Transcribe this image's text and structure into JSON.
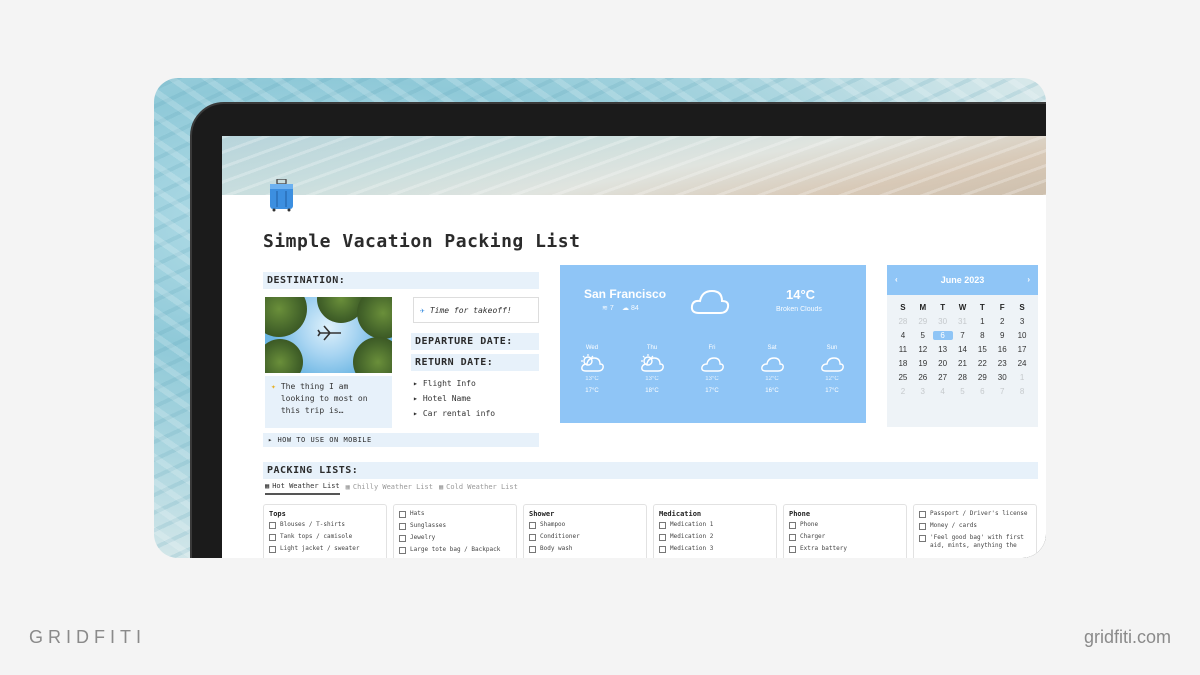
{
  "page": {
    "title": "Simple Vacation Packing List",
    "destination_label": "DESTINATION:",
    "callout": "Time for takeoff!",
    "departure_label": "DEPARTURE DATE:",
    "return_label": "RETURN DATE:",
    "toggles": [
      "Flight Info",
      "Hotel Name",
      "Car rental info"
    ],
    "note": "The thing I am looking to most on this trip is…",
    "mobile_toggle": "HOW TO USE ON MOBILE",
    "packing_label": "PACKING LISTS:"
  },
  "weather": {
    "city": "San Francisco",
    "wind": "7",
    "humidity": "84",
    "temp": "14°C",
    "condition": "Broken Clouds",
    "days": [
      {
        "name": "Wed",
        "low": "13°C",
        "high": "17°C",
        "icon": "sun-cloud-icon"
      },
      {
        "name": "Thu",
        "low": "13°C",
        "high": "18°C",
        "icon": "sun-cloud-icon"
      },
      {
        "name": "Fri",
        "low": "13°C",
        "high": "17°C",
        "icon": "cloud-icon"
      },
      {
        "name": "Sat",
        "low": "12°C",
        "high": "16°C",
        "icon": "cloud-icon"
      },
      {
        "name": "Sun",
        "low": "12°C",
        "high": "17°C",
        "icon": "cloud-icon"
      }
    ]
  },
  "calendar": {
    "month": "June 2023",
    "prev": "‹",
    "next": "›",
    "weekdays": [
      "S",
      "M",
      "T",
      "W",
      "T",
      "F",
      "S"
    ],
    "weeks": [
      [
        "28",
        "29",
        "30",
        "31",
        "1",
        "2",
        "3"
      ],
      [
        "4",
        "5",
        "6",
        "7",
        "8",
        "9",
        "10"
      ],
      [
        "11",
        "12",
        "13",
        "14",
        "15",
        "16",
        "17"
      ],
      [
        "18",
        "19",
        "20",
        "21",
        "22",
        "23",
        "24"
      ],
      [
        "25",
        "26",
        "27",
        "28",
        "29",
        "30",
        "1"
      ],
      [
        "2",
        "3",
        "4",
        "5",
        "6",
        "7",
        "8"
      ]
    ],
    "selected": "6"
  },
  "tabs": [
    "Hot Weather List",
    "Chilly Weather List",
    "Cold Weather List"
  ],
  "lists": [
    {
      "title": "Tops",
      "items": [
        "Blouses / T-shirts",
        "Tank tops / camisole",
        "Light jacket / sweater"
      ]
    },
    {
      "title": "",
      "items": [
        "Hats",
        "Sunglasses",
        "Jewelry",
        "Large tote bag / Backpack"
      ]
    },
    {
      "title": "Shower",
      "items": [
        "Shampoo",
        "Conditioner",
        "Body wash"
      ]
    },
    {
      "title": "Medication",
      "items": [
        "Medication 1",
        "Medication 2",
        "Medication 3"
      ]
    },
    {
      "title": "Phone",
      "items": [
        "Phone",
        "Charger",
        "Extra battery"
      ]
    },
    {
      "title": "",
      "items": [
        "Passport / Driver's license",
        "Money / cards",
        "'Feel good bag' with first aid, mints, anything the"
      ]
    }
  ],
  "brand": {
    "left": "GRIDFITI",
    "right": "gridfiti.com"
  },
  "colors": {
    "accent": "#8fc5f6",
    "section_bg": "#e7f1fa"
  }
}
